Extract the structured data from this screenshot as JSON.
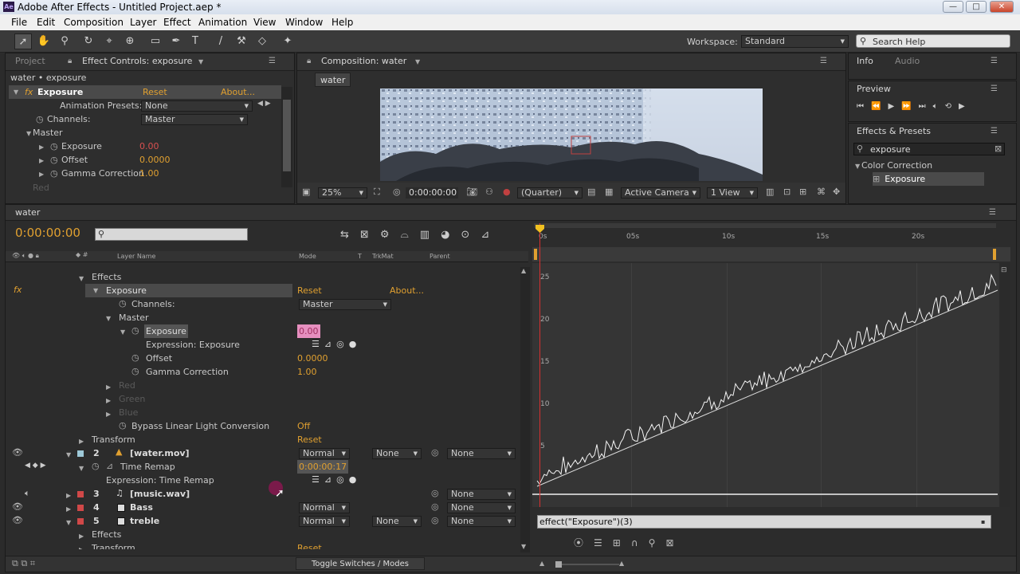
{
  "window": {
    "title": "Adobe After Effects - Untitled Project.aep *",
    "logo": "Ae"
  },
  "menu": [
    "File",
    "Edit",
    "Composition",
    "Layer",
    "Effect",
    "Animation",
    "View",
    "Window",
    "Help"
  ],
  "toolbar": {
    "workspace_label": "Workspace:",
    "workspace_value": "Standard",
    "search_placeholder": "Search Help"
  },
  "effect_controls": {
    "tab_project": "Project",
    "tab_main": "Effect Controls: exposure",
    "breadcrumb": "water • exposure",
    "effect_name": "Exposure",
    "reset": "Reset",
    "about": "About...",
    "presets_label": "Animation Presets:",
    "presets_value": "None",
    "channels_label": "Channels:",
    "channels_value": "Master",
    "master_label": "Master",
    "exposure_label": "Exposure",
    "exposure_value": "0.00",
    "offset_label": "Offset",
    "offset_value": "0.0000",
    "gamma_label": "Gamma Correction",
    "gamma_value": "1.00",
    "cut_label": "Red"
  },
  "composition": {
    "tab": "Composition: water",
    "subtab": "water",
    "zoom": "25%",
    "timecode": "0:00:00:00",
    "resolution": "(Quarter)",
    "camera": "Active Camera",
    "views": "1 View"
  },
  "info": {
    "tab_info": "Info",
    "tab_audio": "Audio",
    "preview": "Preview",
    "effects_presets": "Effects & Presets",
    "search_value": "exposure",
    "category": "Color Correction",
    "item": "Exposure"
  },
  "timeline": {
    "tab": "water",
    "timecode": "0:00:00:00",
    "headers": {
      "layer_name": "Layer Name",
      "mode": "Mode",
      "t": "T",
      "trkmat": "TrkMat",
      "parent": "Parent"
    },
    "effects_label": "Effects",
    "exposure_effect": "Exposure",
    "reset": "Reset",
    "about": "About...",
    "channels_label": "Channels:",
    "channels_value": "Master",
    "master_label": "Master",
    "exposure_prop": "Exposure",
    "exposure_value": "0.00",
    "expression_label": "Expression: Exposure",
    "offset_label": "Offset",
    "offset_value": "0.0000",
    "gamma_label": "Gamma Correction",
    "gamma_value": "1.00",
    "red": "Red",
    "green": "Green",
    "blue": "Blue",
    "bypass_label": "Bypass Linear Light Conversion",
    "bypass_value": "Off",
    "transform_label": "Transform",
    "transform_value": "Reset",
    "layers": [
      {
        "num": "2",
        "name": "[water.mov]",
        "mode": "Normal",
        "trkmat": "None",
        "parent": "None"
      },
      {
        "num": "3",
        "name": "[music.wav]",
        "parent": "None"
      },
      {
        "num": "4",
        "name": "Bass",
        "mode": "Normal",
        "parent": "None"
      },
      {
        "num": "5",
        "name": "treble",
        "mode": "Normal",
        "trkmat": "None",
        "parent": "None"
      }
    ],
    "time_remap_label": "Time Remap",
    "time_remap_value": "0:00:00:17",
    "time_remap_expr": "Expression: Time Remap",
    "effects2": "Effects",
    "transform2": "Transform",
    "transform2_value": "Reset",
    "toggle_label": "Toggle Switches / Modes",
    "ruler": [
      "0s",
      "05s",
      "10s",
      "15s",
      "20s"
    ],
    "graph_y": [
      "25",
      "20",
      "15",
      "10",
      "5"
    ],
    "expression_text": "effect(\"Exposure\")(3)"
  }
}
